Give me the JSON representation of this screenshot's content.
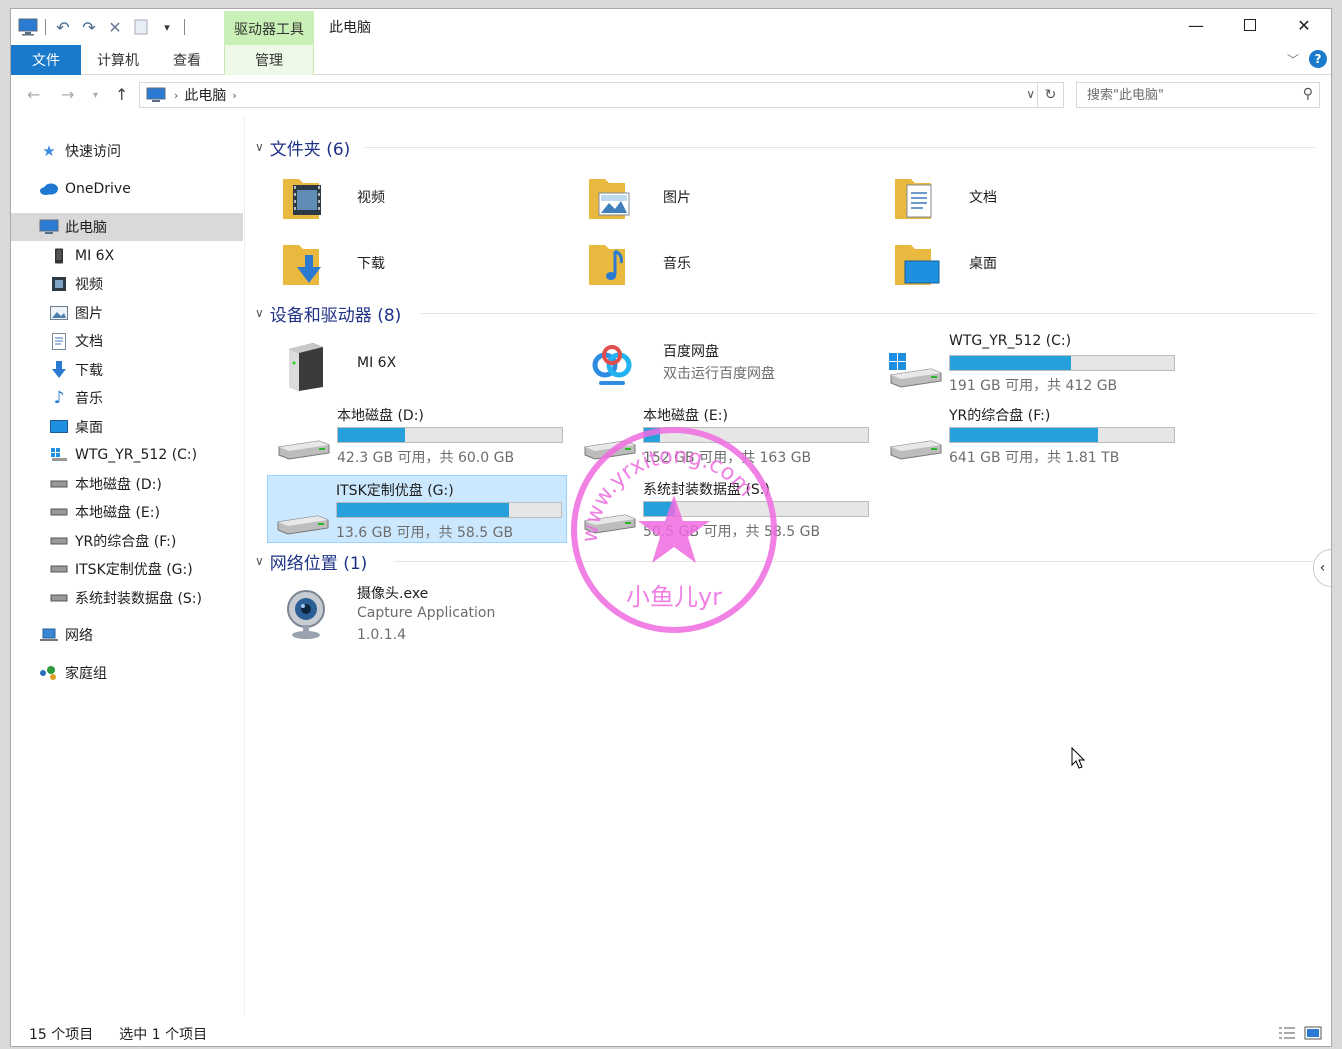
{
  "title_bar": {
    "context_group": "驱动器工具",
    "window_title": "此电脑"
  },
  "ribbon": {
    "tabs": [
      {
        "label": "文件"
      },
      {
        "label": "计算机"
      },
      {
        "label": "查看"
      },
      {
        "label": "管理"
      }
    ]
  },
  "address": {
    "breadcrumb": "此电脑",
    "search_placeholder": "搜索\"此电脑\""
  },
  "nav": {
    "items": [
      {
        "label": "快速访问",
        "icon": "star-icon"
      },
      {
        "label": "OneDrive",
        "icon": "cloud-icon"
      },
      {
        "label": "此电脑",
        "icon": "computer-icon",
        "selected": true
      },
      {
        "label": "MI 6X",
        "icon": "phone-icon"
      },
      {
        "label": "视频",
        "icon": "video-icon"
      },
      {
        "label": "图片",
        "icon": "picture-icon"
      },
      {
        "label": "文档",
        "icon": "document-icon"
      },
      {
        "label": "下载",
        "icon": "download-icon"
      },
      {
        "label": "音乐",
        "icon": "music-icon"
      },
      {
        "label": "桌面",
        "icon": "desktop-icon"
      },
      {
        "label": "WTG_YR_512 (C:)",
        "icon": "windows-drive-icon"
      },
      {
        "label": "本地磁盘 (D:)",
        "icon": "drive-icon"
      },
      {
        "label": "本地磁盘 (E:)",
        "icon": "drive-icon"
      },
      {
        "label": "YR的综合盘 (F:)",
        "icon": "drive-icon"
      },
      {
        "label": "ITSK定制优盘 (G:)",
        "icon": "drive-icon"
      },
      {
        "label": "系统封装数据盘 (S:)",
        "icon": "drive-icon"
      },
      {
        "label": "网络",
        "icon": "network-icon"
      },
      {
        "label": "家庭组",
        "icon": "homegroup-icon"
      }
    ]
  },
  "groups": {
    "folders_title": "文件夹 (6)",
    "devices_title": "设备和驱动器 (8)",
    "network_title": "网络位置 (1)"
  },
  "folders": [
    {
      "label": "视频"
    },
    {
      "label": "图片"
    },
    {
      "label": "文档"
    },
    {
      "label": "下载"
    },
    {
      "label": "音乐"
    },
    {
      "label": "桌面"
    }
  ],
  "devices": {
    "phone": {
      "label": "MI 6X"
    },
    "baidu": {
      "label": "百度网盘",
      "sub": "双击运行百度网盘"
    }
  },
  "drives": [
    {
      "label": "WTG_YR_512 (C:)",
      "free": "191 GB 可用，共 412 GB",
      "used_fraction": 0.54
    },
    {
      "label": "本地磁盘 (D:)",
      "free": "42.3 GB 可用，共 60.0 GB",
      "used_fraction": 0.3
    },
    {
      "label": "本地磁盘 (E:)",
      "free": "152 GB 可用，共 163 GB",
      "used_fraction": 0.07
    },
    {
      "label": "YR的综合盘 (F:)",
      "free": "641 GB 可用，共 1.81 TB",
      "used_fraction": 0.66
    },
    {
      "label": "ITSK定制优盘 (G:)",
      "free": "13.6 GB 可用，共 58.5 GB",
      "used_fraction": 0.77
    },
    {
      "label": "系统封装数据盘 (S:)",
      "free": "50.5 GB 可用，共 58.5 GB",
      "used_fraction": 0.14
    }
  ],
  "network_item": {
    "name": "摄像头.exe",
    "desc": "Capture Application",
    "version": "1.0.1.4"
  },
  "watermark": {
    "text_outer": "www.yrxitong.com",
    "text_inner": "小鱼儿yr"
  },
  "status": {
    "count": "15 个项目",
    "selected": "选中 1 个项目"
  },
  "colors": {
    "accent": "#1979ca",
    "bar_fill": "#26a0da",
    "context_tab": "#c9f0b6",
    "stamp": "#ee6be0"
  }
}
